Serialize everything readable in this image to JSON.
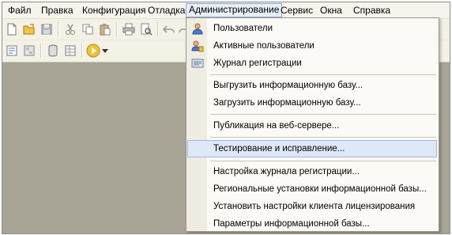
{
  "menubar": {
    "items": [
      "Файл",
      "Правка",
      "Конфигурация",
      "Отладка",
      "Администрирование",
      "Сервис",
      "Окна",
      "Справка"
    ]
  },
  "toolbar": {
    "row1_icons": [
      "new-document-icon",
      "open-folder-icon",
      "save-icon",
      "cut-icon",
      "copy-icon",
      "paste-icon",
      "print-icon",
      "print-preview-icon",
      "undo-icon",
      "redo-icon"
    ],
    "row2_icons": [
      "properties-icon",
      "configuration-tree-icon",
      "database-icon",
      "document-grid-icon",
      "run-debug-icon",
      "dropdown-arrow-icon"
    ]
  },
  "admin_menu": {
    "items": [
      {
        "label": "Пользователи",
        "icon": "user-icon"
      },
      {
        "label": "Активные пользователи",
        "icon": "active-users-icon"
      },
      {
        "label": "Журнал регистрации",
        "icon": "event-log-icon"
      },
      {
        "label": "Выгрузить информационную базу..."
      },
      {
        "label": "Загрузить информационную базу..."
      },
      {
        "label": "Публикация на веб-сервере..."
      },
      {
        "label": "Тестирование и исправление..."
      },
      {
        "label": "Настройка журнала регистрации..."
      },
      {
        "label": "Региональные установки информационной базы..."
      },
      {
        "label": "Установить настройки клиента лицензирования"
      },
      {
        "label": "Параметры информационной базы..."
      }
    ]
  },
  "colors": {
    "workspace": "#a8a596",
    "menubar": "#f6f4ec",
    "highlight": "#dfe8f6",
    "highlight_border": "#a0b8de"
  }
}
